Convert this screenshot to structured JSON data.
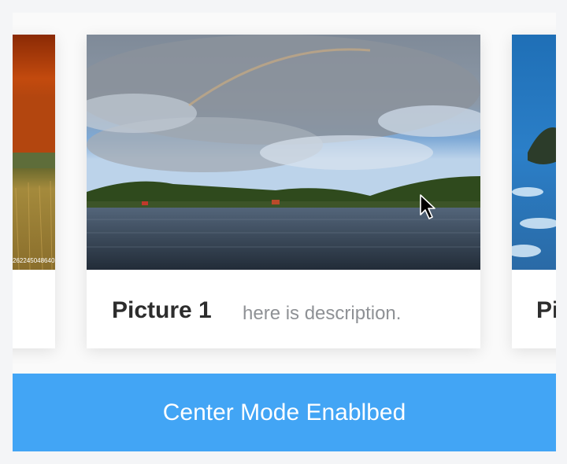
{
  "slides": [
    {
      "title": "",
      "description": ""
    },
    {
      "title": "Picture 1",
      "description": "here is description."
    },
    {
      "title": "Pi",
      "description": ""
    }
  ],
  "left_image_caption": "262245048640",
  "mode_button": {
    "label": "Center Mode Enablbed"
  }
}
